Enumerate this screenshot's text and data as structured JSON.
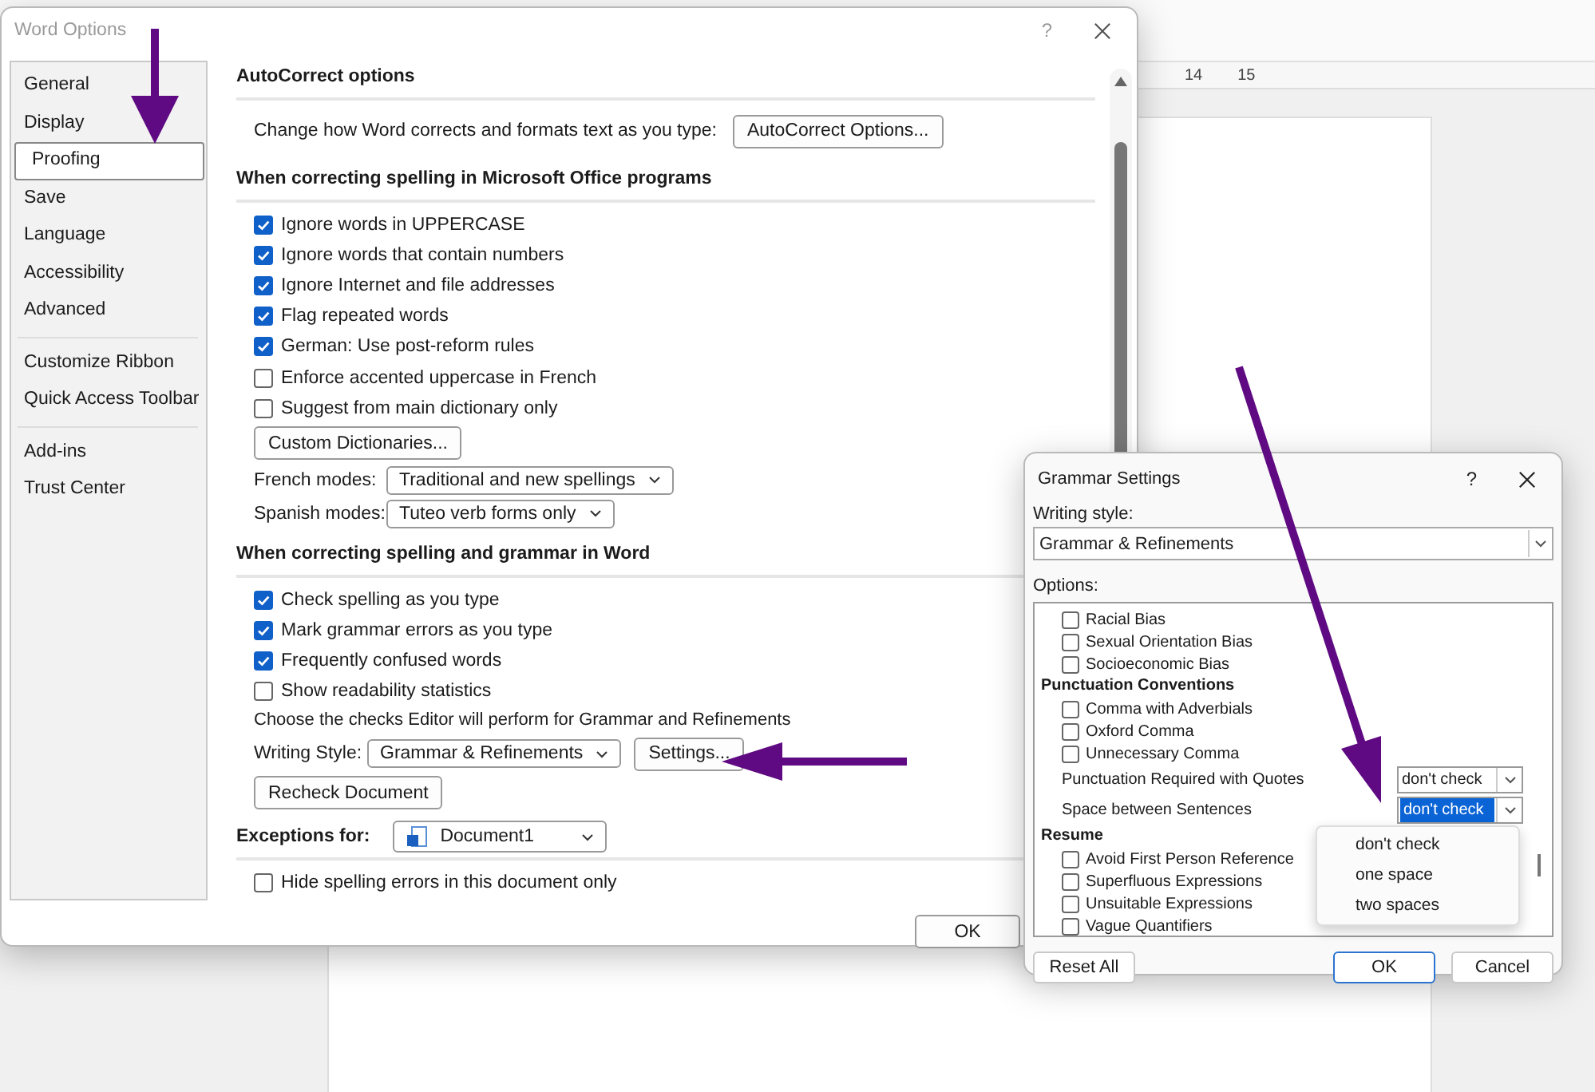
{
  "word_app": {
    "ruler_labels": [
      "14",
      "15"
    ]
  },
  "options_dialog": {
    "title": "Word Options",
    "help": "?",
    "sidebar_groups": [
      {
        "items": [
          {
            "label": "General",
            "selected": false
          },
          {
            "label": "Display",
            "selected": false
          },
          {
            "label": "Proofing",
            "selected": true
          },
          {
            "label": "Save",
            "selected": false
          },
          {
            "label": "Language",
            "selected": false
          },
          {
            "label": "Accessibility",
            "selected": false
          },
          {
            "label": "Advanced",
            "selected": false
          }
        ]
      },
      {
        "items": [
          {
            "label": "Customize Ribbon",
            "selected": false
          },
          {
            "label": "Quick Access Toolbar",
            "selected": false
          }
        ]
      },
      {
        "items": [
          {
            "label": "Add-ins",
            "selected": false
          },
          {
            "label": "Trust Center",
            "selected": false
          }
        ]
      }
    ],
    "sections": [
      {
        "heading": "AutoCorrect options",
        "rows": [
          {
            "kind": "label_button",
            "label": "Change how Word corrects and formats text as you type:",
            "button": "AutoCorrect Options..."
          }
        ]
      },
      {
        "heading": "When correcting spelling in Microsoft Office programs",
        "rows": [
          {
            "kind": "checkbox",
            "label": "Ignore words in UPPERCASE",
            "checked": true
          },
          {
            "kind": "checkbox",
            "label": "Ignore words that contain numbers",
            "checked": true
          },
          {
            "kind": "checkbox",
            "label": "Ignore Internet and file addresses",
            "checked": true
          },
          {
            "kind": "checkbox",
            "label": "Flag repeated words",
            "checked": true
          },
          {
            "kind": "checkbox",
            "label": "German: Use post-reform rules",
            "checked": true
          },
          {
            "kind": "checkbox",
            "label": "Enforce accented uppercase in French",
            "checked": false
          },
          {
            "kind": "checkbox",
            "label": "Suggest from main dictionary only",
            "checked": false
          },
          {
            "kind": "button",
            "button": "Custom Dictionaries..."
          },
          {
            "kind": "select",
            "label": "French modes:",
            "value": "Traditional and new spellings"
          },
          {
            "kind": "select",
            "label": "Spanish modes:",
            "value": "Tuteo verb forms only"
          }
        ]
      },
      {
        "heading": "When correcting spelling and grammar in Word",
        "rows": [
          {
            "kind": "checkbox",
            "label": "Check spelling as you type",
            "checked": true
          },
          {
            "kind": "checkbox",
            "label": "Mark grammar errors as you type",
            "checked": true
          },
          {
            "kind": "checkbox",
            "label": "Frequently confused words",
            "checked": true
          },
          {
            "kind": "checkbox",
            "label": "Show readability statistics",
            "checked": false
          },
          {
            "kind": "text",
            "text": "Choose the checks Editor will perform for Grammar and Refinements"
          },
          {
            "kind": "select",
            "label": "Writing Style:",
            "value": "Grammar & Refinements",
            "button": "Settings..."
          },
          {
            "kind": "button",
            "button": "Recheck Document"
          }
        ]
      },
      {
        "heading": "Exceptions for:",
        "heading_select": "Document1",
        "rows": [
          {
            "kind": "checkbox",
            "label": "Hide spelling errors in this document only",
            "checked": false
          }
        ]
      }
    ],
    "ok_button": "OK"
  },
  "grammar_dialog": {
    "title": "Grammar Settings",
    "help": "?",
    "writing_style_label": "Writing style:",
    "writing_style_value": "Grammar & Refinements",
    "options_label": "Options:",
    "options": [
      {
        "kind": "checkbox",
        "label": "Racial Bias",
        "checked": false
      },
      {
        "kind": "checkbox",
        "label": "Sexual Orientation Bias",
        "checked": false
      },
      {
        "kind": "checkbox",
        "label": "Socioeconomic Bias",
        "checked": false
      },
      {
        "kind": "heading",
        "label": "Punctuation Conventions"
      },
      {
        "kind": "checkbox",
        "label": "Comma with Adverbials",
        "checked": false
      },
      {
        "kind": "checkbox",
        "label": "Oxford Comma",
        "checked": false
      },
      {
        "kind": "checkbox",
        "label": "Unnecessary Comma",
        "checked": false
      },
      {
        "kind": "select",
        "label": "Punctuation Required with Quotes",
        "value": "don't check",
        "focused": false
      },
      {
        "kind": "select",
        "label": "Space between Sentences",
        "value": "don't check",
        "focused": true
      },
      {
        "kind": "heading",
        "label": "Resume"
      },
      {
        "kind": "checkbox",
        "label": "Avoid First Person Reference",
        "checked": false
      },
      {
        "kind": "checkbox",
        "label": "Superfluous Expressions",
        "checked": false
      },
      {
        "kind": "checkbox",
        "label": "Unsuitable Expressions",
        "checked": false
      },
      {
        "kind": "checkbox",
        "label": "Vague Quantifiers",
        "checked": false
      }
    ],
    "dropdown_options": [
      "don't check",
      "one space",
      "two spaces"
    ],
    "buttons": [
      {
        "label": "Reset All",
        "default": false
      },
      {
        "label": "OK",
        "default": true
      },
      {
        "label": "Cancel",
        "default": false
      }
    ]
  }
}
